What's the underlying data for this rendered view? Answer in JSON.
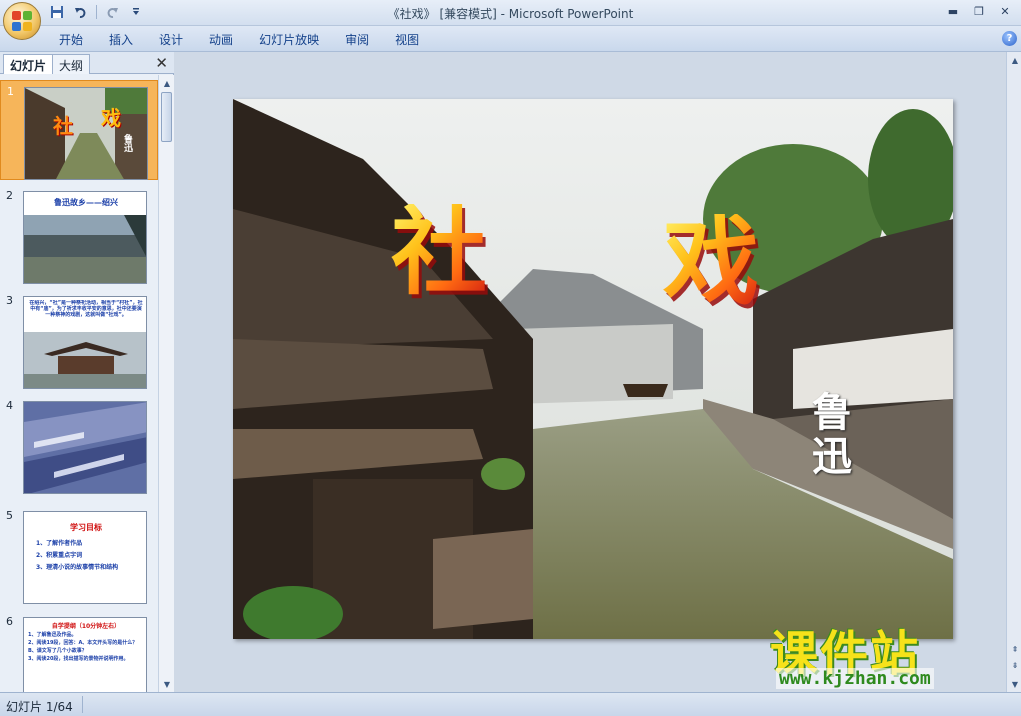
{
  "titlebar": {
    "title": "《社戏》 [兼容模式] - Microsoft PowerPoint",
    "qat": [
      "save-icon",
      "undo-icon",
      "redo-icon",
      "customize-icon"
    ],
    "controls": {
      "minimize": "▬",
      "maximize": "❐",
      "close": "✕"
    }
  },
  "ribbon": {
    "tabs": [
      "开始",
      "插入",
      "设计",
      "动画",
      "幻灯片放映",
      "审阅",
      "视图"
    ],
    "help": "?"
  },
  "panel": {
    "tabs": [
      "幻灯片",
      "大纲"
    ],
    "close": "✕",
    "thumbnails": [
      {
        "num": "1",
        "text": [
          "社",
          "戏",
          "鲁迅"
        ]
      },
      {
        "num": "2",
        "text": [
          "鲁迅故乡——绍兴"
        ]
      },
      {
        "num": "3",
        "text": [
          "在绍兴，“社”是一种祭祀活动，相当于“村社”，社中有“庙”，为了祈求丰收平安的意思，社中还要演一种祭神的戏剧，这就叫做“社戏”。"
        ]
      },
      {
        "num": "4",
        "text": []
      },
      {
        "num": "5",
        "text": [
          "学习目标",
          "1、了解作者作品",
          "2、积累重点字词",
          "3、理清小说的故事情节和结构"
        ]
      },
      {
        "num": "6",
        "text": [
          "自学提纲（10分钟左右）",
          "1、了解鲁迅及作品。",
          "2、阅读19段，回答：A、本文开头写的是什么？",
          "B、课文写了几个小故事？",
          "3、阅读20段，找出描写的景物并说明作用。"
        ]
      }
    ]
  },
  "slide": {
    "title_char1": "社",
    "title_char2": "戏",
    "author": "鲁迅"
  },
  "watermark": {
    "name": "课件站",
    "url": "www.kjzhan.com"
  },
  "status": {
    "slide_counter": "幻灯片 1/64"
  },
  "colors": {
    "accent_orange": "#f6b55a",
    "ribbon_text": "#15428b",
    "canal_water": "#7e8a5a"
  }
}
